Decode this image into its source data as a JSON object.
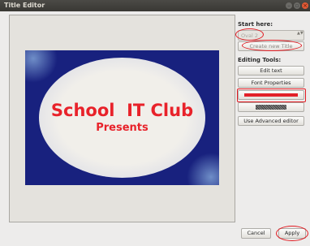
{
  "window": {
    "title": "Title Editor"
  },
  "window_controls": {
    "minimize": "–",
    "maximize": "▫",
    "close": "×"
  },
  "slide": {
    "line1": "School  IT Club",
    "line2": "Presents"
  },
  "sidebar": {
    "start_label": "Start here:",
    "template_select": "Oval 2",
    "template_arrows": "▲▼",
    "create_button": "Create new Title",
    "editing_label": "Editing Tools:",
    "edit_text_button": "Edit text",
    "font_properties_button": "Font Properties",
    "advanced_editor_button": "Use Advanced editor"
  },
  "colors": {
    "text_color": "#e22028",
    "highlight": "#e21b22",
    "slide_background": "#18217e"
  },
  "footer": {
    "cancel_button": "Cancel",
    "apply_button": "Apply"
  }
}
